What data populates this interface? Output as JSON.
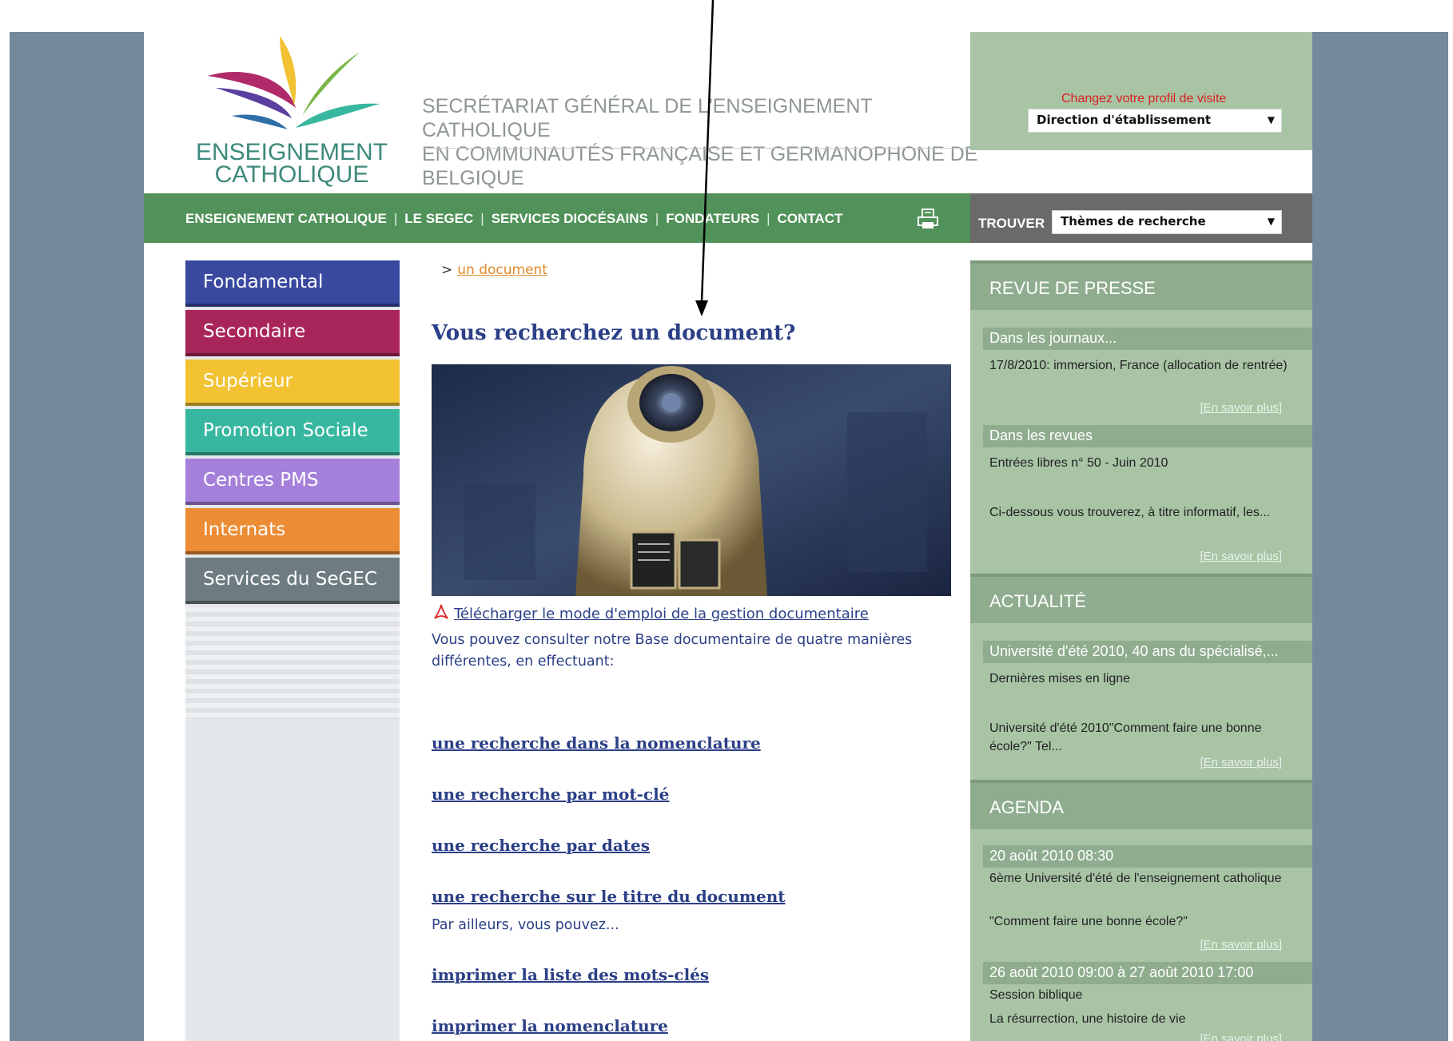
{
  "header": {
    "logo_line1": "ENSEIGNEMENT",
    "logo_line2": "CATHOLIQUE",
    "org_line1": "SECRÉTARIAT GÉNÉRAL DE L'ENSEIGNEMENT CATHOLIQUE",
    "org_line2": "EN COMMUNAUTÉS FRANÇAISE ET GERMANOPHONE DE BELGIQUE",
    "profile_label": "Changez votre profil de visite",
    "profile_value": "Direction d'établissement"
  },
  "nav": {
    "items": [
      "ENSEIGNEMENT CATHOLIQUE",
      "LE SEGEC",
      "SERVICES DIOCÉSAINS",
      "FONDATEURS",
      "CONTACT"
    ],
    "find_label": "TROUVER",
    "find_value": "Thèmes de recherche"
  },
  "sidebar": {
    "items": [
      {
        "label": "Fondamental",
        "color": "#3a49a0"
      },
      {
        "label": "Secondaire",
        "color": "#a8255a"
      },
      {
        "label": "Supérieur",
        "color": "#f2c232"
      },
      {
        "label": "Promotion Sociale",
        "color": "#38b7a0"
      },
      {
        "label": "Centres PMS",
        "color": "#a580da"
      },
      {
        "label": "Internats",
        "color": "#ec8c34"
      },
      {
        "label": "Services du SeGEC",
        "color": "#6e7c82"
      }
    ]
  },
  "main": {
    "breadcrumb_sep": ">",
    "breadcrumb_link": "un document",
    "title": "Vous recherchez un document?",
    "pdf_link": "Télécharger le mode d'emploi de la gestion documentaire",
    "intro": "Vous pouvez consulter notre Base documentaire de quatre manières différentes, en effectuant:",
    "links": [
      "une recherche dans la nomenclature",
      "une recherche par mot-clé",
      "une recherche par dates",
      "une recherche sur le titre du document"
    ],
    "also_text": "Par ailleurs, vous pouvez...",
    "print_links": [
      "imprimer la liste des mots-clés",
      "imprimer la nomenclature"
    ]
  },
  "right": {
    "press_title": "REVUE DE PRESSE",
    "journals_title": "Dans les journaux...",
    "journals_text": "17/8/2010: immersion, France (allocation de rentrée)",
    "more_label": "[En savoir plus]",
    "revues_title": "Dans les revues",
    "revues_text1": "Entrées libres n° 50 - Juin 2010",
    "revues_text2": "Ci-dessous vous trouverez, à titre informatif, les...",
    "news_title": "ACTUALITÉ",
    "news_sub": "Université d'été 2010, 40 ans du spécialisé,...",
    "news_text1": "Dernières mises en ligne",
    "news_text2": "Université d'été 2010\"Comment faire une bonne école?\" Tel...",
    "agenda_title": "AGENDA",
    "agenda1_date": "20 août 2010 08:30",
    "agenda1_text1": "6ème Université d'été de l'enseignement catholique",
    "agenda1_text2": "\"Comment faire une bonne école?\"",
    "agenda2_date": "26 août 2010 09:00 à 27 août 2010 17:00",
    "agenda2_text1": "Session biblique",
    "agenda2_text2": "La résurrection, une histoire de vie"
  },
  "colors": {
    "nav_green": "#51925a",
    "panel_green": "#a8c4a5",
    "title_blue": "#2b3f86",
    "frame_slate": "#74899a"
  }
}
